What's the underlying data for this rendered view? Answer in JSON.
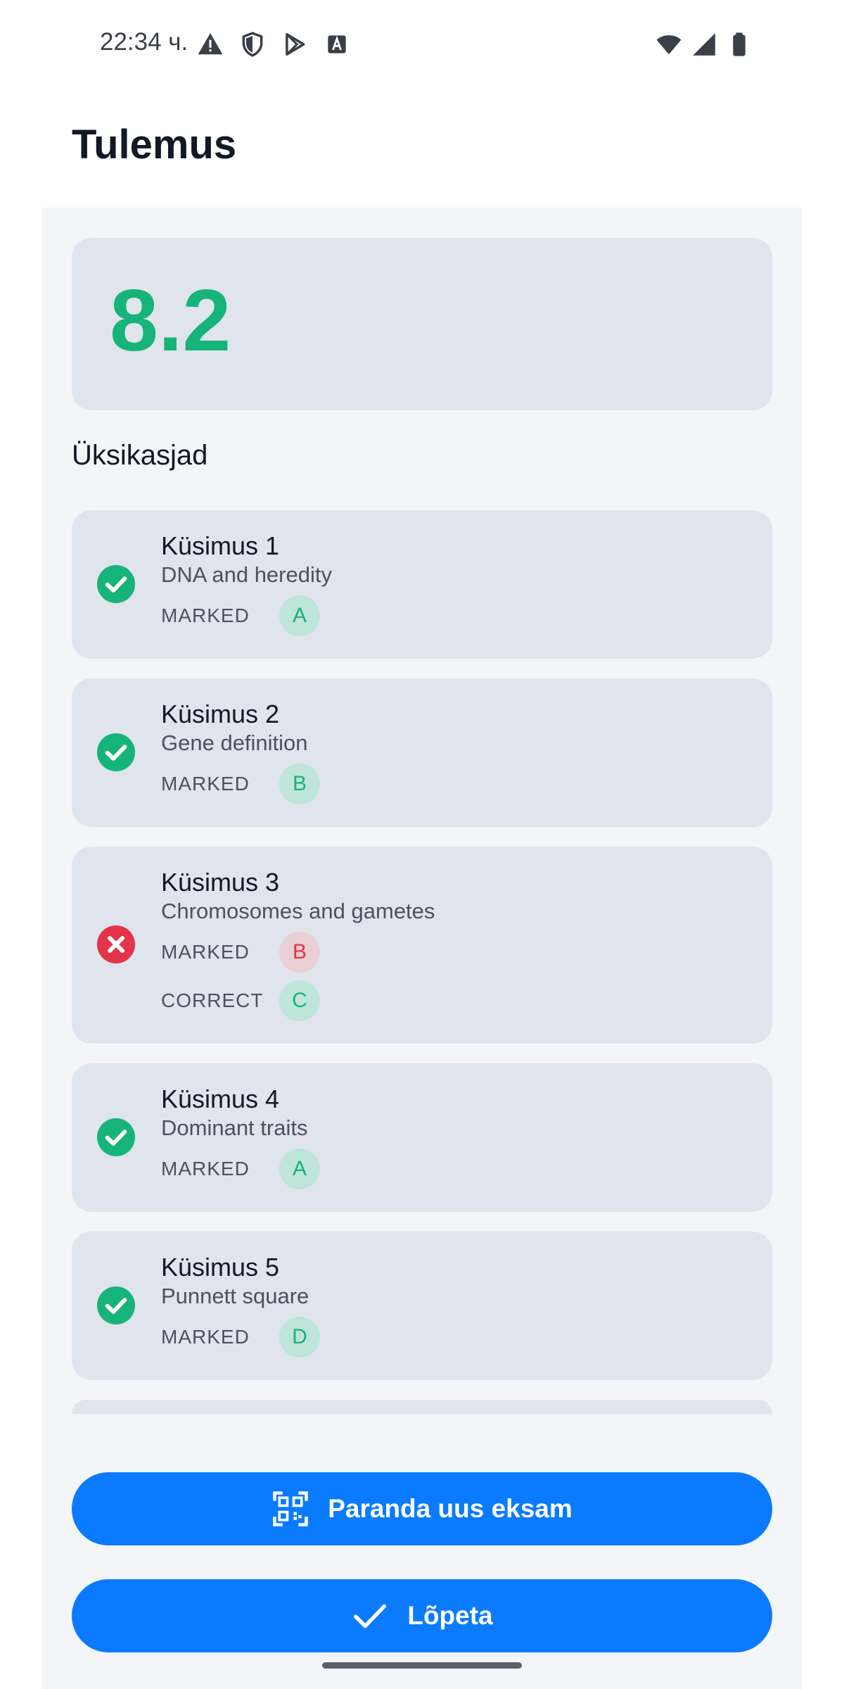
{
  "status_bar": {
    "time": "22:34 ч.",
    "icons_left": [
      "warning-icon",
      "shield-icon",
      "play-store-icon",
      "font-icon"
    ],
    "icons_right": [
      "wifi-icon",
      "cellular-icon",
      "battery-icon"
    ]
  },
  "header": {
    "title": "Tulemus"
  },
  "score": {
    "value": "8.2",
    "color": "#16b47a"
  },
  "section": {
    "heading": "Üksikasjad"
  },
  "labels": {
    "marked": "MARKED",
    "correct": "CORRECT"
  },
  "questions": [
    {
      "title": "Küsimus 1",
      "subtitle": "DNA and heredity",
      "status": "correct",
      "marked": "A"
    },
    {
      "title": "Küsimus 2",
      "subtitle": "Gene definition",
      "status": "correct",
      "marked": "B"
    },
    {
      "title": "Küsimus 3",
      "subtitle": "Chromosomes and gametes",
      "status": "incorrect",
      "marked": "B",
      "correct": "C"
    },
    {
      "title": "Küsimus 4",
      "subtitle": "Dominant traits",
      "status": "correct",
      "marked": "A"
    },
    {
      "title": "Küsimus 5",
      "subtitle": "Punnett square",
      "status": "correct",
      "marked": "D"
    }
  ],
  "buttons": {
    "scan_label": "Paranda uus eksam",
    "finish_label": "Lõpeta"
  },
  "colors": {
    "accent": "#0a7bff",
    "success": "#16b47a",
    "error": "#e3344a",
    "card": "#e0e4ec"
  }
}
